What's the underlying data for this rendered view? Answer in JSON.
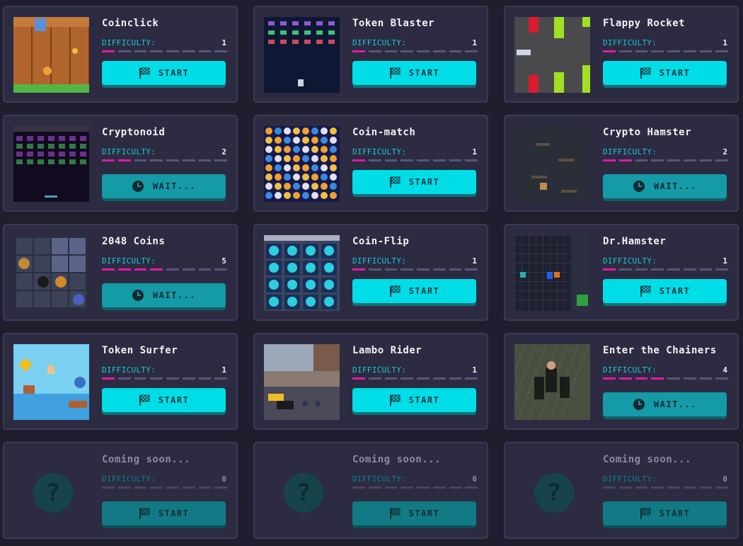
{
  "colors": {
    "background": "#1f1e2e",
    "card": "#2c2b41",
    "accent_cyan": "#00dde6",
    "difficulty_pink": "#e01aa8",
    "difficulty_label": "#19c8d6"
  },
  "difficulty_label": "DIFFICULTY:",
  "max_difficulty": 5,
  "games": [
    {
      "title": "Coinclick",
      "difficulty": "1",
      "level": 1,
      "button": "START",
      "state": "start",
      "thumb": "fence"
    },
    {
      "title": "Token Blaster",
      "difficulty": "1",
      "level": 1,
      "button": "START",
      "state": "start",
      "thumb": "space"
    },
    {
      "title": "Flappy Rocket",
      "difficulty": "1",
      "level": 1,
      "button": "START",
      "state": "start",
      "thumb": "pipes"
    },
    {
      "title": "Cryptonoid",
      "difficulty": "2",
      "level": 2,
      "button": "WAIT...",
      "state": "wait",
      "thumb": "bricks"
    },
    {
      "title": "Coin-match",
      "difficulty": "1",
      "level": 1,
      "button": "START",
      "state": "start",
      "thumb": "match"
    },
    {
      "title": "Crypto Hamster",
      "difficulty": "2",
      "level": 2,
      "button": "WAIT...",
      "state": "wait",
      "thumb": "hamster"
    },
    {
      "title": "2048 Coins",
      "difficulty": "5",
      "level": 5,
      "button": "WAIT...",
      "state": "wait",
      "thumb": "grid2048"
    },
    {
      "title": "Coin-Flip",
      "difficulty": "1",
      "level": 1,
      "button": "START",
      "state": "start",
      "thumb": "flip"
    },
    {
      "title": "Dr.Hamster",
      "difficulty": "1",
      "level": 1,
      "button": "START",
      "state": "start",
      "thumb": "drhamster"
    },
    {
      "title": "Token Surfer",
      "difficulty": "1",
      "level": 1,
      "button": "START",
      "state": "start",
      "thumb": "surfer"
    },
    {
      "title": "Lambo Rider",
      "difficulty": "1",
      "level": 1,
      "button": "START",
      "state": "start",
      "thumb": "city"
    },
    {
      "title": "Enter the Chainers",
      "difficulty": "4",
      "level": 4,
      "button": "WAIT...",
      "state": "wait",
      "thumb": "chainers"
    },
    {
      "title": "Coming soon...",
      "difficulty": "0",
      "level": 0,
      "button": "START",
      "state": "disabled",
      "thumb": "question-icon"
    },
    {
      "title": "Coming soon...",
      "difficulty": "0",
      "level": 0,
      "button": "START",
      "state": "disabled",
      "thumb": "question-icon"
    },
    {
      "title": "Coming soon...",
      "difficulty": "0",
      "level": 0,
      "button": "START",
      "state": "disabled",
      "thumb": "question-icon"
    }
  ],
  "icons": {
    "start": "checkered-flag-icon",
    "wait": "clock-icon",
    "placeholder": "question-icon",
    "placeholder_glyph": "?"
  }
}
